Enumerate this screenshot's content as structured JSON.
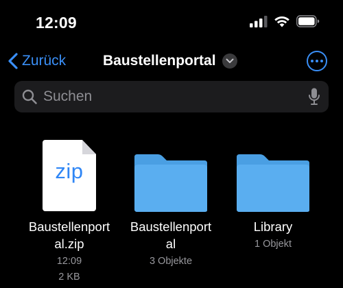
{
  "status_bar": {
    "time": "12:09",
    "signal_icon": "cellular-signal-icon",
    "wifi_icon": "wifi-icon",
    "battery_icon": "battery-icon"
  },
  "nav": {
    "back_label": "Zurück",
    "title": "Baustellenportal",
    "accent_color": "#3a8ff7"
  },
  "search": {
    "placeholder": "Suchen",
    "search_icon": "magnifying-glass-icon",
    "mic_icon": "microphone-icon"
  },
  "items": [
    {
      "name_line1": "Baustellenport",
      "name_line2": "al.zip",
      "meta1": "12:09",
      "meta2": "2 KB",
      "icon": "zip-file-icon",
      "icon_text": "zip"
    },
    {
      "name_line1": "Baustellenport",
      "name_line2": "al",
      "meta1": "3 Objekte",
      "icon": "folder-icon"
    },
    {
      "name_line1": "Library",
      "meta1": "1 Objekt",
      "icon": "folder-icon"
    }
  ],
  "colors": {
    "folder": "#5aaef0",
    "folder_tab": "#4a9fe3",
    "zip_text": "#2f86f5"
  }
}
